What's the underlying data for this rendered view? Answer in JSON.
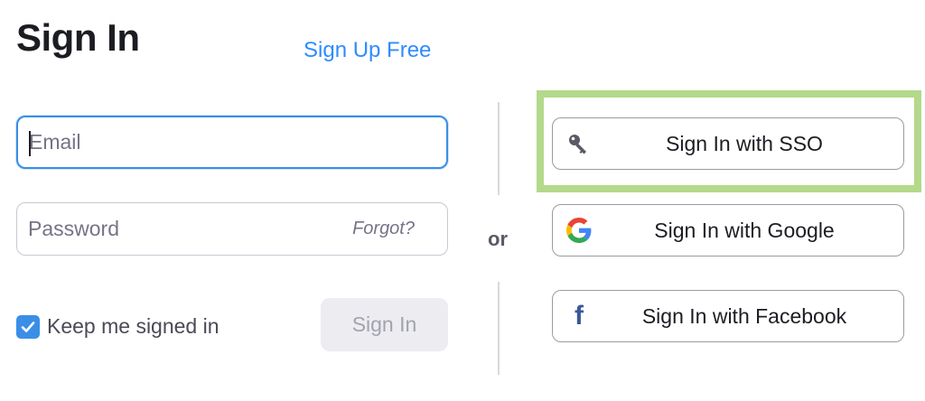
{
  "header": {
    "title": "Sign In",
    "signup_link": "Sign Up Free"
  },
  "form": {
    "email": {
      "value": "",
      "placeholder": "Email"
    },
    "password": {
      "value": "",
      "placeholder": "Password",
      "forgot_label": "Forgot?"
    },
    "keep_signed_in": {
      "label": "Keep me signed in",
      "checked": true
    },
    "submit_label": "Sign In"
  },
  "separator": {
    "label": "or"
  },
  "alternatives": {
    "sso": {
      "label": "Sign In with SSO",
      "icon": "key-icon",
      "highlighted": true
    },
    "google": {
      "label": "Sign In with Google",
      "icon": "google-icon"
    },
    "facebook": {
      "label": "Sign In with Facebook",
      "icon": "facebook-icon"
    }
  },
  "colors": {
    "accent": "#2d8cff",
    "input_focus": "#3a8ee6",
    "highlight": "#b3d98a",
    "facebook": "#3b5998"
  }
}
